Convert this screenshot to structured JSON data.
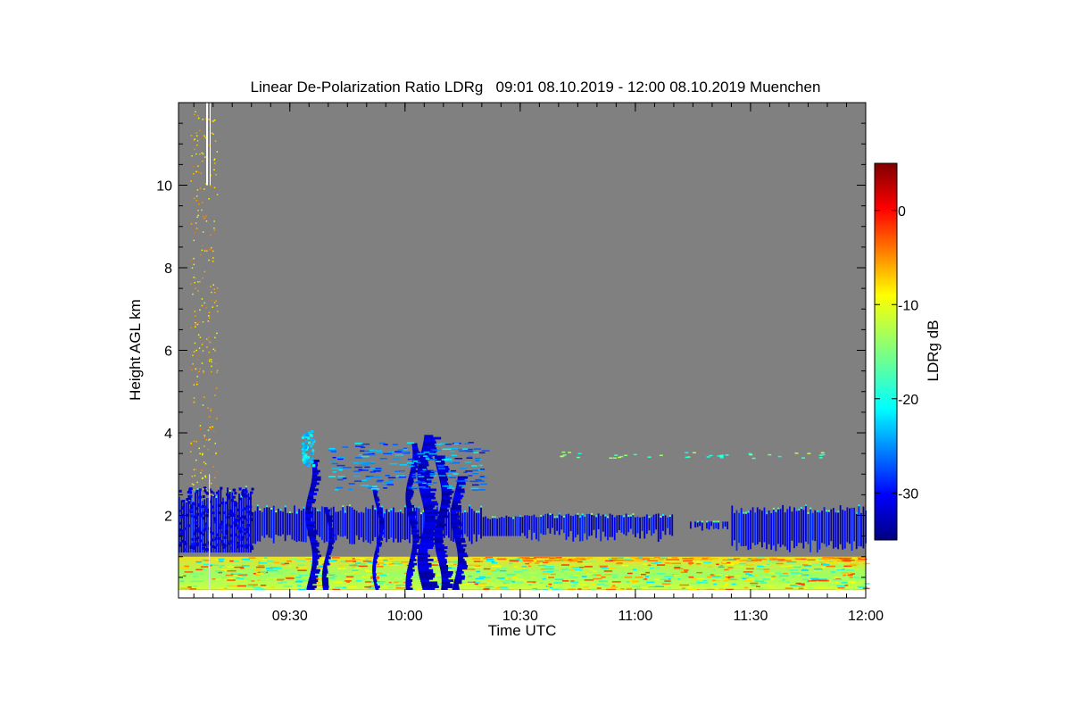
{
  "chart_data": {
    "type": "heatmap",
    "title": "Linear De-Polarization Ratio LDRg   09:01 08.10.2019 - 12:00 08.10.2019 Muenchen",
    "xlabel": "Time UTC",
    "ylabel": "Height AGL km",
    "x_ticks": [
      "09:30",
      "10:00",
      "10:30",
      "11:00",
      "11:30",
      "12:00"
    ],
    "xlim": [
      "09:01",
      "12:00"
    ],
    "y_ticks": [
      2,
      4,
      6,
      8,
      10
    ],
    "ylim": [
      0,
      12
    ],
    "colorbar": {
      "label": "LDRg dB",
      "ticks": [
        0,
        -10,
        -20,
        -30
      ],
      "range": [
        -35,
        5
      ],
      "colormap": "jet"
    },
    "colors": {
      "background_no_signal": "#808080",
      "plot_frame": "#000000"
    },
    "features": [
      {
        "name": "boundary layer aerosol",
        "height_km": [
          0.2,
          1.0
        ],
        "ldr_db": -12,
        "time": [
          "09:01",
          "12:00"
        ]
      },
      {
        "name": "low cloud layer",
        "height_km": [
          1.2,
          2.2
        ],
        "ldr_db": -33,
        "time": [
          "09:01",
          "12:00"
        ]
      },
      {
        "name": "convective cloud columns",
        "height_km": [
          0.2,
          3.9
        ],
        "ldr_db": -33,
        "time": [
          "09:38",
          "10:16"
        ]
      },
      {
        "name": "ice cloud top",
        "height_km": [
          3.2,
          4.1
        ],
        "ldr_db": -22,
        "time": [
          "09:33",
          "09:36"
        ]
      }
    ]
  }
}
